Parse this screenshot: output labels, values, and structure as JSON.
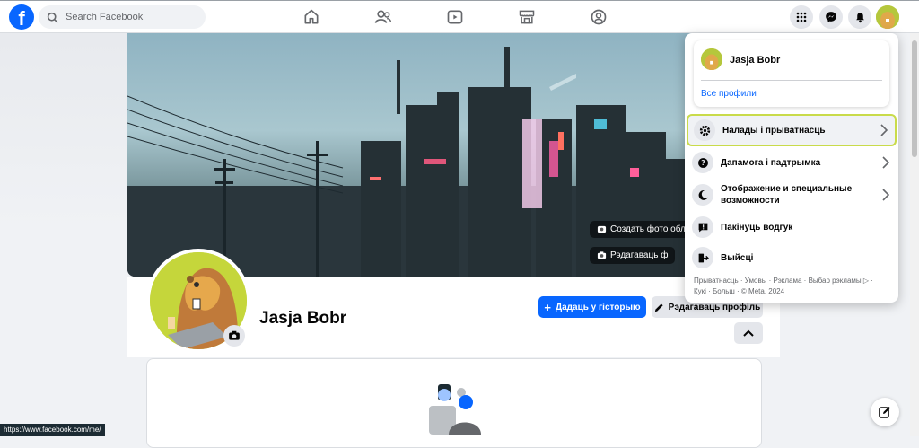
{
  "topbar": {
    "logo_glyph": "f",
    "search_placeholder": "Search Facebook",
    "nav_icons": [
      "home-icon",
      "friends-icon",
      "video-icon",
      "marketplace-icon",
      "groups-icon"
    ],
    "right_icons": [
      "menu-grid-icon",
      "messenger-icon",
      "bell-icon"
    ]
  },
  "cover": {
    "create_photo_label": "Создать фото обл",
    "edit_cover_label": "Рэдагаваць ф"
  },
  "profile": {
    "name": "Jasja Bobr",
    "add_story_label": "Дадаць у гісторыю",
    "edit_profile_label": "Рэдагаваць профіль"
  },
  "account_menu": {
    "profile_name": "Jasja Bobr",
    "all_profiles_label": "Все профили",
    "items": [
      {
        "label": "Налады і прыватнасць",
        "icon": "gear-icon",
        "has_chevron": true
      },
      {
        "label": "Дапамога і падтрымка",
        "icon": "help-icon",
        "has_chevron": true
      },
      {
        "label": "Отображение и специальные возможности",
        "icon": "moon-icon",
        "has_chevron": true
      },
      {
        "label": "Пакінуць водгук",
        "icon": "feedback-icon",
        "has_chevron": false
      },
      {
        "label": "Выйсці",
        "icon": "logout-icon",
        "has_chevron": false
      }
    ],
    "footer_line1": "Прыватнасць · Умовы · Рэклама · Выбар рэкламы ▷ ·",
    "footer_line2": "Кукі · Больш · © Meta, 2024"
  },
  "status_bar": {
    "url": "https://www.facebook.com/me/"
  },
  "colors": {
    "brand_blue": "#0866ff",
    "highlight": "#c9db4a",
    "avatar_bg": "#c5d63b"
  }
}
